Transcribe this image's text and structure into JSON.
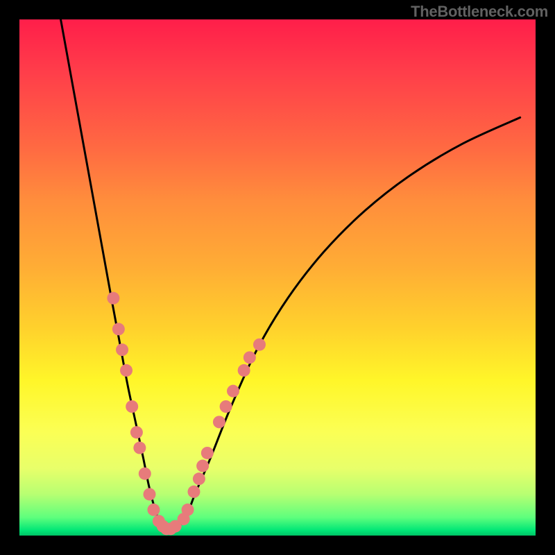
{
  "watermark": "TheBottleneck.com",
  "chart_data": {
    "type": "line",
    "title": "",
    "xlabel": "",
    "ylabel": "",
    "xlim": [
      0,
      100
    ],
    "ylim": [
      0,
      100
    ],
    "series": [
      {
        "name": "curve",
        "x": [
          8,
          10,
          12,
          14,
          16,
          18,
          19.5,
          21,
          22.5,
          24,
          25,
          26,
          27,
          28,
          29,
          30,
          32,
          34,
          37,
          41,
          46,
          52,
          59,
          67,
          76,
          86,
          97
        ],
        "y": [
          100,
          89,
          78,
          67,
          56,
          45,
          37,
          29,
          22,
          15,
          10,
          6,
          3,
          1.5,
          1,
          1.5,
          3,
          8,
          15,
          25,
          36,
          46,
          55,
          63,
          70,
          76,
          81
        ]
      }
    ],
    "markers": [
      {
        "x": 18.2,
        "y": 46
      },
      {
        "x": 19.2,
        "y": 40
      },
      {
        "x": 19.9,
        "y": 36
      },
      {
        "x": 20.7,
        "y": 32
      },
      {
        "x": 21.8,
        "y": 25
      },
      {
        "x": 22.7,
        "y": 20
      },
      {
        "x": 23.3,
        "y": 17
      },
      {
        "x": 24.3,
        "y": 12
      },
      {
        "x": 25.2,
        "y": 8
      },
      {
        "x": 26.0,
        "y": 5
      },
      {
        "x": 27.0,
        "y": 2.8
      },
      {
        "x": 27.8,
        "y": 1.8
      },
      {
        "x": 28.5,
        "y": 1.3
      },
      {
        "x": 29.3,
        "y": 1.3
      },
      {
        "x": 30.2,
        "y": 1.8
      },
      {
        "x": 31.8,
        "y": 3.2
      },
      {
        "x": 32.6,
        "y": 5
      },
      {
        "x": 33.8,
        "y": 8.5
      },
      {
        "x": 34.8,
        "y": 11
      },
      {
        "x": 35.5,
        "y": 13.5
      },
      {
        "x": 36.4,
        "y": 16
      },
      {
        "x": 38.7,
        "y": 22
      },
      {
        "x": 40.0,
        "y": 25
      },
      {
        "x": 41.4,
        "y": 28
      },
      {
        "x": 43.5,
        "y": 32
      },
      {
        "x": 44.6,
        "y": 34.5
      },
      {
        "x": 46.5,
        "y": 37
      }
    ],
    "marker_color": "#e77b7b"
  }
}
